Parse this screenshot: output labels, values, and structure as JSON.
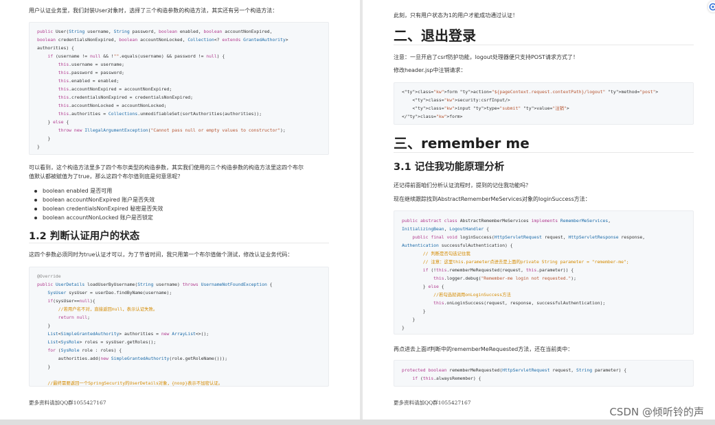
{
  "left": {
    "intro": "用户认证业务里，我们封装User对象时，选择了三个构造参数的构造方法，其实还有另一个构造方法：",
    "code1": [
      "public User(String username, String password, boolean enabled, boolean accountNonExpired,",
      "boolean credentialsNonExpired, boolean accountNonLocked, Collection<? extends GrantedAuthority>",
      "authorities) {",
      "    if (username != null && !\"\".equals(username) && password != null) {",
      "        this.username = username;",
      "        this.password = password;",
      "        this.enabled = enabled;",
      "        this.accountNonExpired = accountNonExpired;",
      "        this.credentialsNonExpired = credentialsNonExpired;",
      "        this.accountNonLocked = accountNonLocked;",
      "        this.authorities = Collections.unmodifiableSet(sortAuthorities(authorities));",
      "    } else {",
      "        throw new IllegalArgumentException(\"Cannot pass null or empty values to constructor\");",
      "    }",
      "}"
    ],
    "para2_line1": "可以看到，这个构造方法里多了四个布尔类型的构造参数，其实我们使用的三个构造参数的构造方法里这四个布尔",
    "para2_line2": "值默认都被赋值为了true，那么这四个布尔值到底是何意思呢？",
    "bullets": [
      "boolean enabled  是否可用",
      "boolean accountNonExpired 账户是否失效",
      "boolean credentialsNonExpired 秘密是否失效",
      "boolean accountNonLocked 账户是否锁定"
    ],
    "heading": "1.2 判断认证用户的状态",
    "para3": "这四个参数必须同时为true认证才可以，为了节省时间，我只用第一个布尔值做个测试，修改认证业务代码：",
    "code2": [
      "@Override",
      "public UserDetails loadUserByUsername(String username) throws UsernameNotFoundException {",
      "    SysUser sysUser = userDao.findByName(username);",
      "    if(sysUser==null){",
      "        //若用户名不对，直接返回null，表示认证失败。",
      "        return null;",
      "    }",
      "    List<SimpleGrantedAuthority> authorities = new ArrayList<>();",
      "    List<SysRole> roles = sysUser.getRoles();",
      "    for (SysRole role : roles) {",
      "        authorities.add(new SimpleGrantedAuthority(role.getRoleName()));",
      "    }",
      "",
      "    //最终需要返回一个SpringSecurity的UserDetails对象，{noop}表示不加密认证。"
    ],
    "footer": "更多资料请加QQ群1055427167"
  },
  "right": {
    "top_line": "此刻，只有用户状态为1的用户才能成功通过认证！",
    "h1_logout": "二、退出登录",
    "note": "注意：一旦开启了csrf防护功能，logout处理器便只支持POST请求方式了！",
    "modify": "修改header.jsp中注销请求：",
    "code3": [
      "<form action=\"${pageContext.request.contextPath}/logout\" method=\"post\">",
      "    <security:csrfInput/>",
      "    <input type=\"submit\" value=\"注销\">",
      "</form>"
    ],
    "h1_remember": "三、remember me",
    "h2_analysis": "3.1 记住我功能原理分析",
    "recall": "还记得前面咱们分析认证流程时，提到的记住我功能吗？",
    "find": "现在继续跟踪找到AbstractRememberMeServices对象的loginSuccess方法：",
    "code4": [
      "public abstract class AbstractRememberMeServices implements RememberMeServices,",
      "InitializingBean, LogoutHandler {",
      "    public final void loginSuccess(HttpServletRequest request, HttpServletResponse response,",
      "Authentication successfulAuthentication) {",
      "        // 判断是否勾选记住我",
      "        // 注意：这里this.parameter点进去是上面的private String parameter = \"remember-me\";",
      "        if (!this.rememberMeRequested(request, this.parameter)) {",
      "            this.logger.debug(\"Remember-me login not requested.\");",
      "        } else {",
      "            //若勾选就调用onLoginSuccess方法",
      "            this.onLoginSuccess(request, response, successfulAuthentication);",
      "        }",
      "    }",
      "}"
    ],
    "click_in": "再点进去上面if判断中的rememberMeRequested方法，还在当前类中：",
    "code5": [
      "protected boolean rememberMeRequested(HttpServletRequest request, String parameter) {",
      "    if (this.alwaysRemember) {"
    ],
    "footer": "更多资料请加QQ群1055427167"
  },
  "watermark": "CSDN @倾听铃的声",
  "pin_icon": "edge-pin-icon"
}
